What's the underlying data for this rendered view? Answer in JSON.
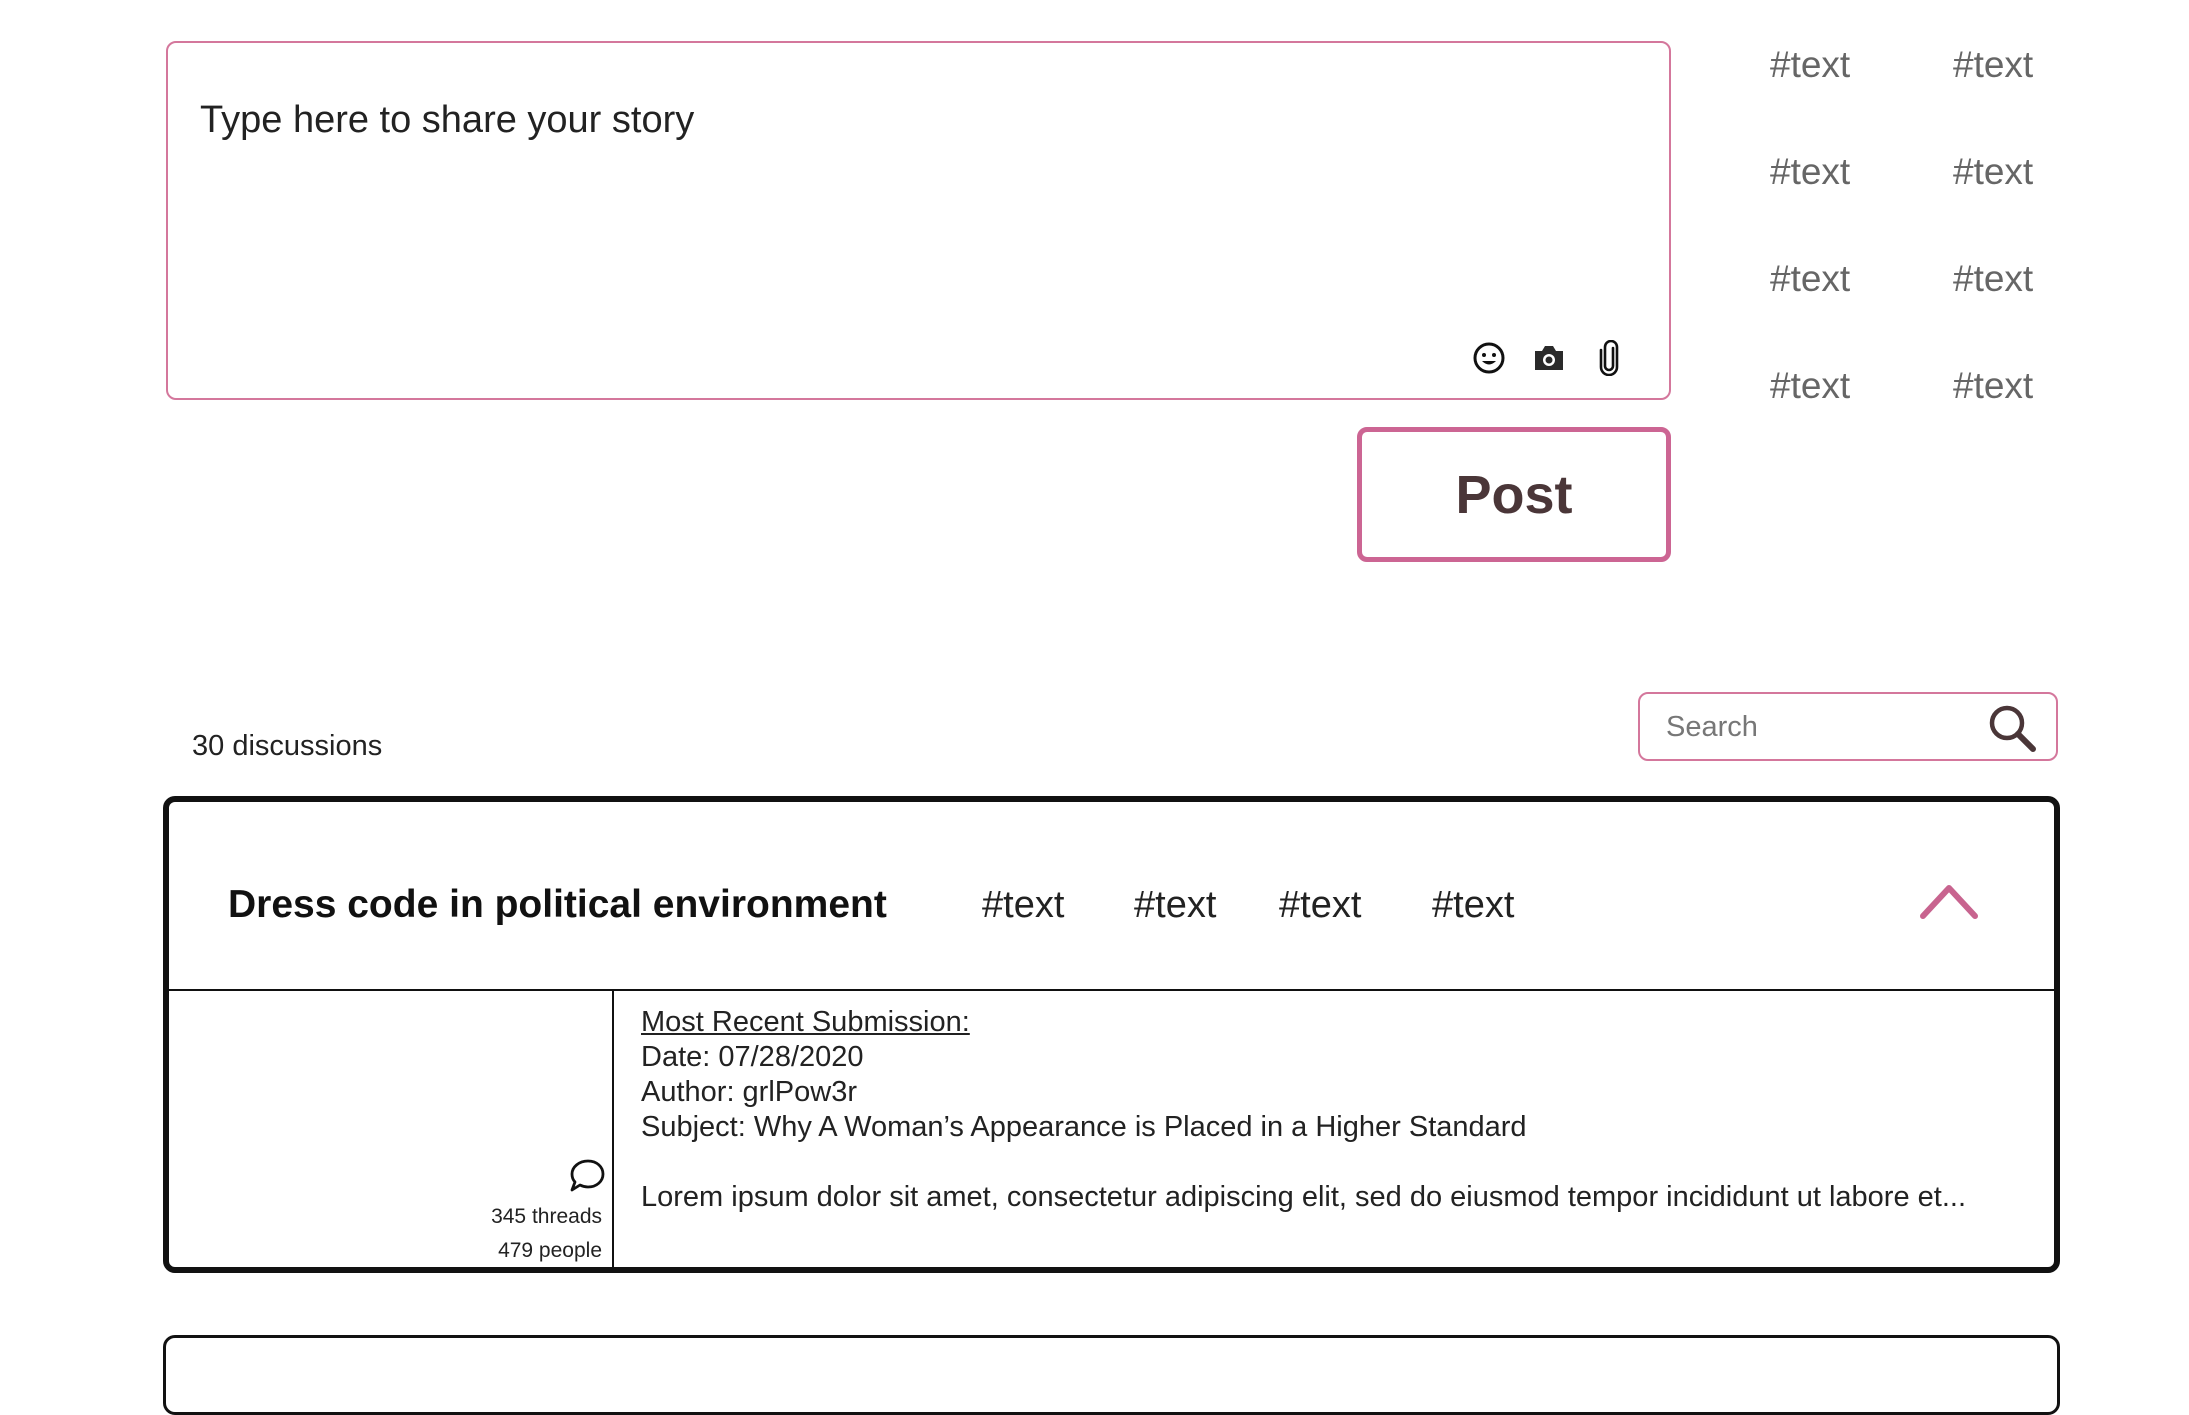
{
  "composer": {
    "placeholder": "Type here to share your story",
    "icons": [
      "smiley-icon",
      "camera-icon",
      "paperclip-icon"
    ]
  },
  "post_button": {
    "label": "Post"
  },
  "side_tags": [
    "#text",
    "#text",
    "#text",
    "#text",
    "#text",
    "#text",
    "#text",
    "#text"
  ],
  "discussions": {
    "count_label": "30 discussions"
  },
  "search": {
    "placeholder": "Search",
    "icon": "magnifier-icon"
  },
  "colors": {
    "accent": "#cc6593",
    "post_text": "#4a3638",
    "border_dark": "#111111"
  },
  "card": {
    "title": "Dress code in political environment",
    "tags": [
      "#text",
      "#text",
      "#text",
      "#text"
    ],
    "collapse_icon": "chevron-up-icon",
    "threads": "345 threads",
    "people": "479 people",
    "submission": {
      "heading": "Most Recent Submission:",
      "date": "Date: 07/28/2020",
      "author": "Author: grlPow3r",
      "subject": "Subject: Why A Woman’s Appearance is Placed in a Higher Standard",
      "excerpt": "Lorem ipsum dolor sit amet, consectetur adipiscing elit, sed do eiusmod tempor incididunt ut labore et..."
    }
  }
}
